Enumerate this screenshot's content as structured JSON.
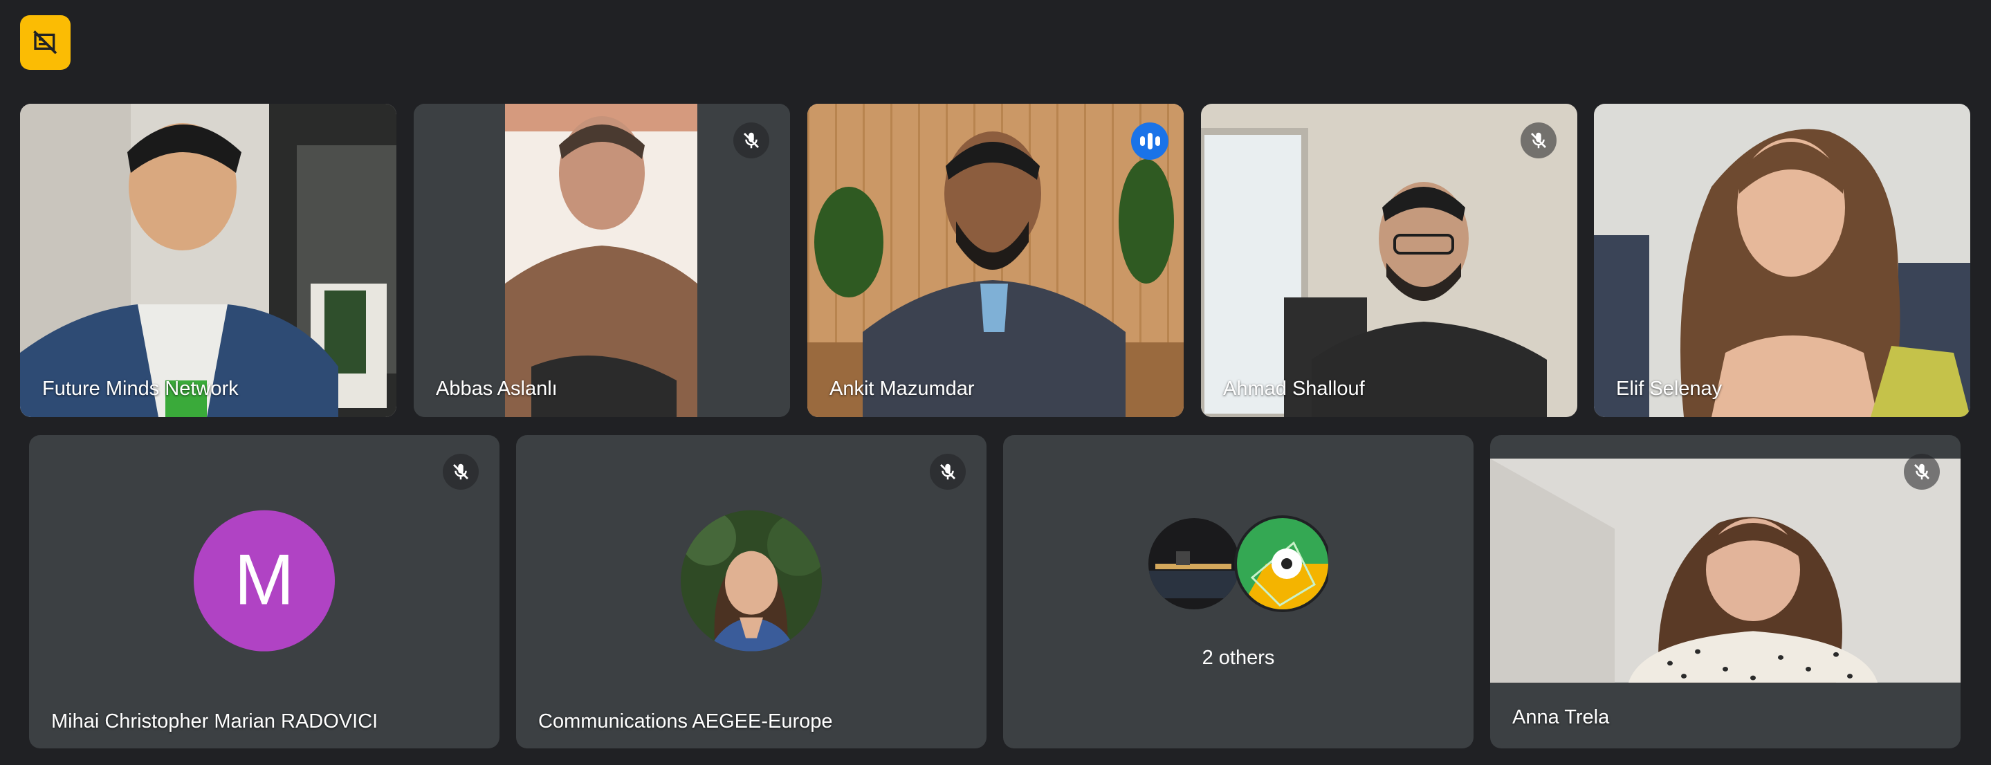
{
  "badge": {
    "icon": "presentation-off-icon"
  },
  "row1": [
    {
      "name": "Future Minds Network",
      "mic": "on",
      "speaking": false
    },
    {
      "name": "Abbas Aslanlı",
      "mic": "muted",
      "speaking": false
    },
    {
      "name": "Ankit Mazumdar",
      "mic": "on",
      "speaking": true
    },
    {
      "name": "Ahmad Shallouf",
      "mic": "muted",
      "speaking": false
    },
    {
      "name": "Elif Selenay",
      "mic": "on",
      "speaking": false
    }
  ],
  "row2": [
    {
      "name": "Mihai Christopher Marian RADOVICI",
      "mic": "muted",
      "avatar_letter": "M",
      "avatar_color": "#b043c4"
    },
    {
      "name": "Communications AEGEE-Europe",
      "mic": "muted",
      "avatar": "profile-photo"
    },
    {
      "others_label": "2 others"
    },
    {
      "name": "Anna Trela",
      "mic": "muted"
    }
  ],
  "colors": {
    "background": "#202124",
    "tile": "#3c4043",
    "active_border": "#8ab4f8",
    "speaking": "#1a73e8",
    "badge": "#fbbc04"
  }
}
